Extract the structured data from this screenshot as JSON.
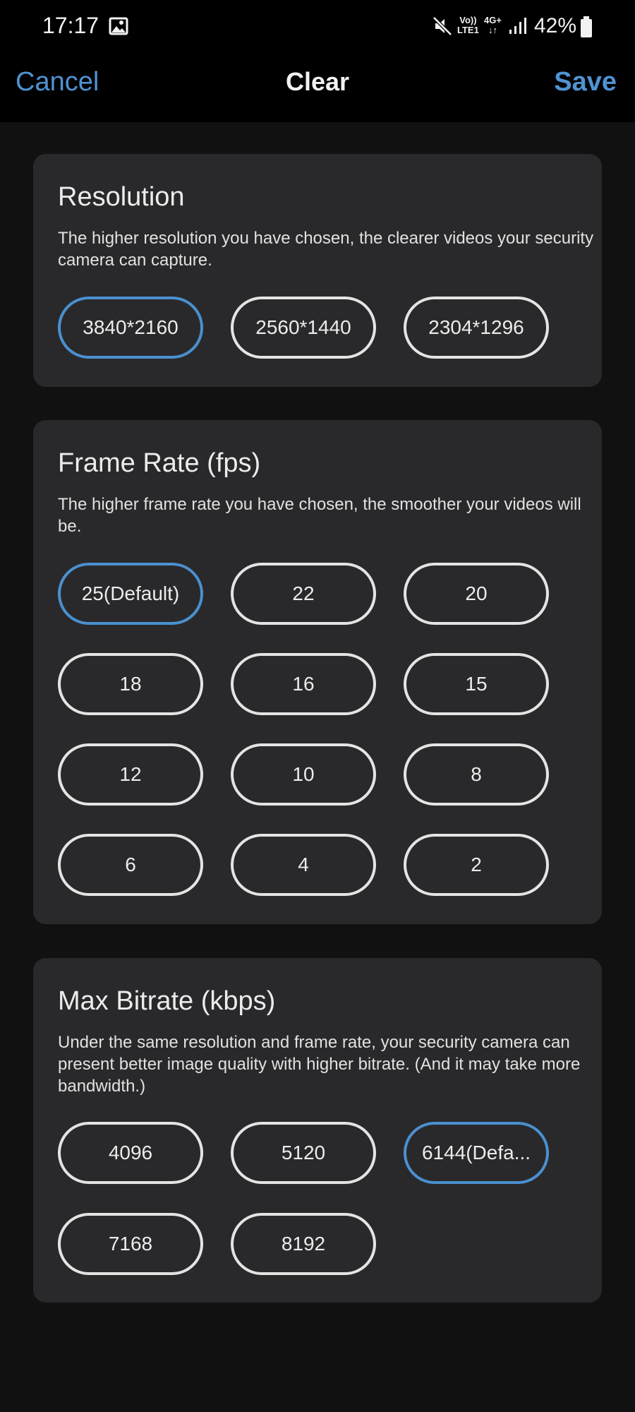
{
  "status_bar": {
    "time": "17:17",
    "network_left": "Vo))\nLTE1",
    "network_right": "4G+\n↓↑",
    "battery": "42%"
  },
  "header": {
    "cancel_label": "Cancel",
    "title": "Clear",
    "save_label": "Save",
    "accent_color": "#4f93d2"
  },
  "resolution": {
    "title": "Resolution",
    "description": "The higher resolution you have chosen, the clearer videos your security camera can capture.",
    "options": [
      "3840*2160",
      "2560*1440",
      "2304*1296"
    ],
    "selected": "3840*2160"
  },
  "frame_rate": {
    "title": "Frame Rate (fps)",
    "description": "The higher frame rate you have chosen, the smoother your videos will be.",
    "options": [
      "25(Default)",
      "22",
      "20",
      "18",
      "16",
      "15",
      "12",
      "10",
      "8",
      "6",
      "4",
      "2"
    ],
    "selected": "25(Default)"
  },
  "bitrate": {
    "title": "Max Bitrate (kbps)",
    "description": "Under the same resolution and frame rate, your security camera can present better image quality with higher bitrate. (And it may take more bandwidth.)",
    "options": [
      "4096",
      "5120",
      "6144(Defa...",
      "7168",
      "8192"
    ],
    "selected": "6144(Defa..."
  }
}
